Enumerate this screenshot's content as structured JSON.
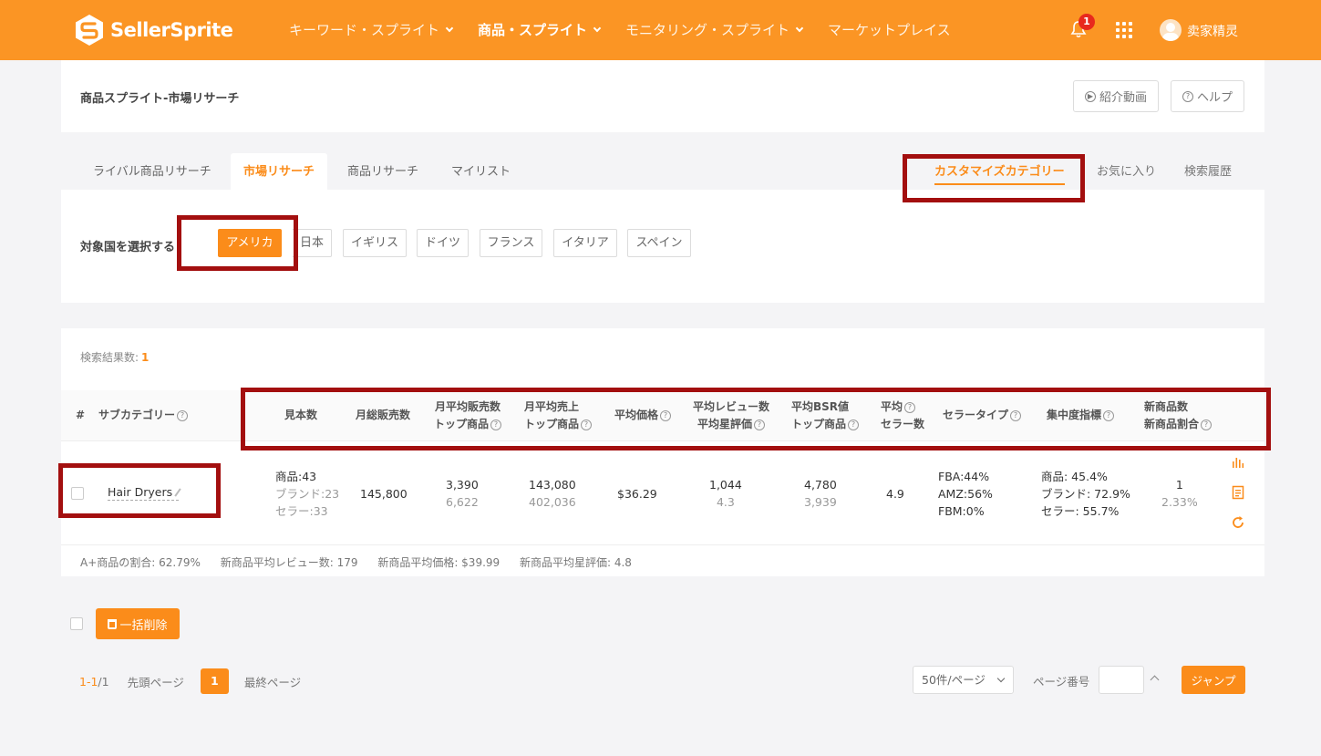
{
  "header": {
    "brand": "SellerSprite",
    "nav": [
      {
        "label": "キーワード・スプライト"
      },
      {
        "label": "商品・スプライト"
      },
      {
        "label": "モニタリング・スプライト"
      },
      {
        "label": "マーケットプレイス"
      }
    ],
    "notification_count": "1",
    "username": "卖家精灵"
  },
  "page": {
    "title": "商品スプライト-市場リサーチ",
    "intro_video": "紹介動画",
    "help": "ヘルプ"
  },
  "tabs": {
    "left": [
      {
        "label": "ライバル商品リサーチ"
      },
      {
        "label": "市場リサーチ"
      },
      {
        "label": "商品リサーチ"
      },
      {
        "label": "マイリスト"
      }
    ],
    "right": [
      {
        "label": "カスタマイズカテゴリー"
      },
      {
        "label": "お気に入り"
      },
      {
        "label": "検索履歴"
      }
    ]
  },
  "country": {
    "label": "対象国を選択する",
    "options": [
      {
        "label": "アメリカ"
      },
      {
        "label": "日本"
      },
      {
        "label": "イギリス"
      },
      {
        "label": "ドイツ"
      },
      {
        "label": "フランス"
      },
      {
        "label": "イタリア"
      },
      {
        "label": "スペイン"
      }
    ],
    "selected": "アメリカ"
  },
  "results": {
    "count_label": "検索結果数:",
    "count": "1",
    "columns": {
      "index": "#",
      "subcategory": "サブカテゴリー",
      "samples": "見本数",
      "monthly_total_sales": "月総販売数",
      "avg_monthly_sales_1": "月平均販売数",
      "avg_monthly_sales_2": "トップ商品",
      "avg_monthly_revenue_1": "月平均売上",
      "avg_monthly_revenue_2": "トップ商品",
      "avg_price": "平均価格",
      "avg_reviews_1": "平均レビュー数",
      "avg_reviews_2": "平均星評価",
      "avg_bsr_1": "平均BSR値",
      "avg_bsr_2": "トップ商品",
      "avg_sellers_1": "平均",
      "avg_sellers_2": "セラー数",
      "seller_type": "セラータイプ",
      "concentration": "集中度指標",
      "new_products_1": "新商品数",
      "new_products_2": "新商品割合"
    },
    "rows": [
      {
        "subcategory": "Hair Dryers",
        "samples_products": "商品:43",
        "samples_brands": "ブランド:23",
        "samples_sellers": "セラー:33",
        "monthly_total_sales": "145,800",
        "avg_monthly_sales": "3,390",
        "avg_monthly_sales_top": "6,622",
        "avg_monthly_revenue": "143,080",
        "avg_monthly_revenue_top": "402,036",
        "avg_price": "$36.29",
        "avg_reviews": "1,044",
        "avg_rating": "4.3",
        "avg_bsr": "4,780",
        "avg_bsr_top": "3,939",
        "avg_sellers": "4.9",
        "seller_fba": "FBA:44%",
        "seller_amz": "AMZ:56%",
        "seller_fbm": "FBM:0%",
        "conc_products": "商品: 45.4%",
        "conc_brands": "ブランド: 72.9%",
        "conc_sellers": "セラー: 55.7%",
        "new_products": "1",
        "new_products_ratio": "2.33%"
      }
    ],
    "footer": {
      "aplus": "A+商品の割合: 62.79%",
      "new_avg_reviews": "新商品平均レビュー数: 179",
      "new_avg_price": "新商品平均価格: $39.99",
      "new_avg_rating": "新商品平均星評価: 4.8"
    }
  },
  "bulk": {
    "delete_label": "一括削除"
  },
  "pagination": {
    "range": "1-1",
    "total": "/1",
    "first": "先頭ページ",
    "current": "1",
    "last": "最終ページ",
    "per_page": "50件/ページ",
    "goto_label": "ページ番号",
    "jump": "ジャンプ"
  },
  "colors": {
    "brand": "#fb9524",
    "accent": "#fb8c1a",
    "highlight": "#a30f0f"
  }
}
